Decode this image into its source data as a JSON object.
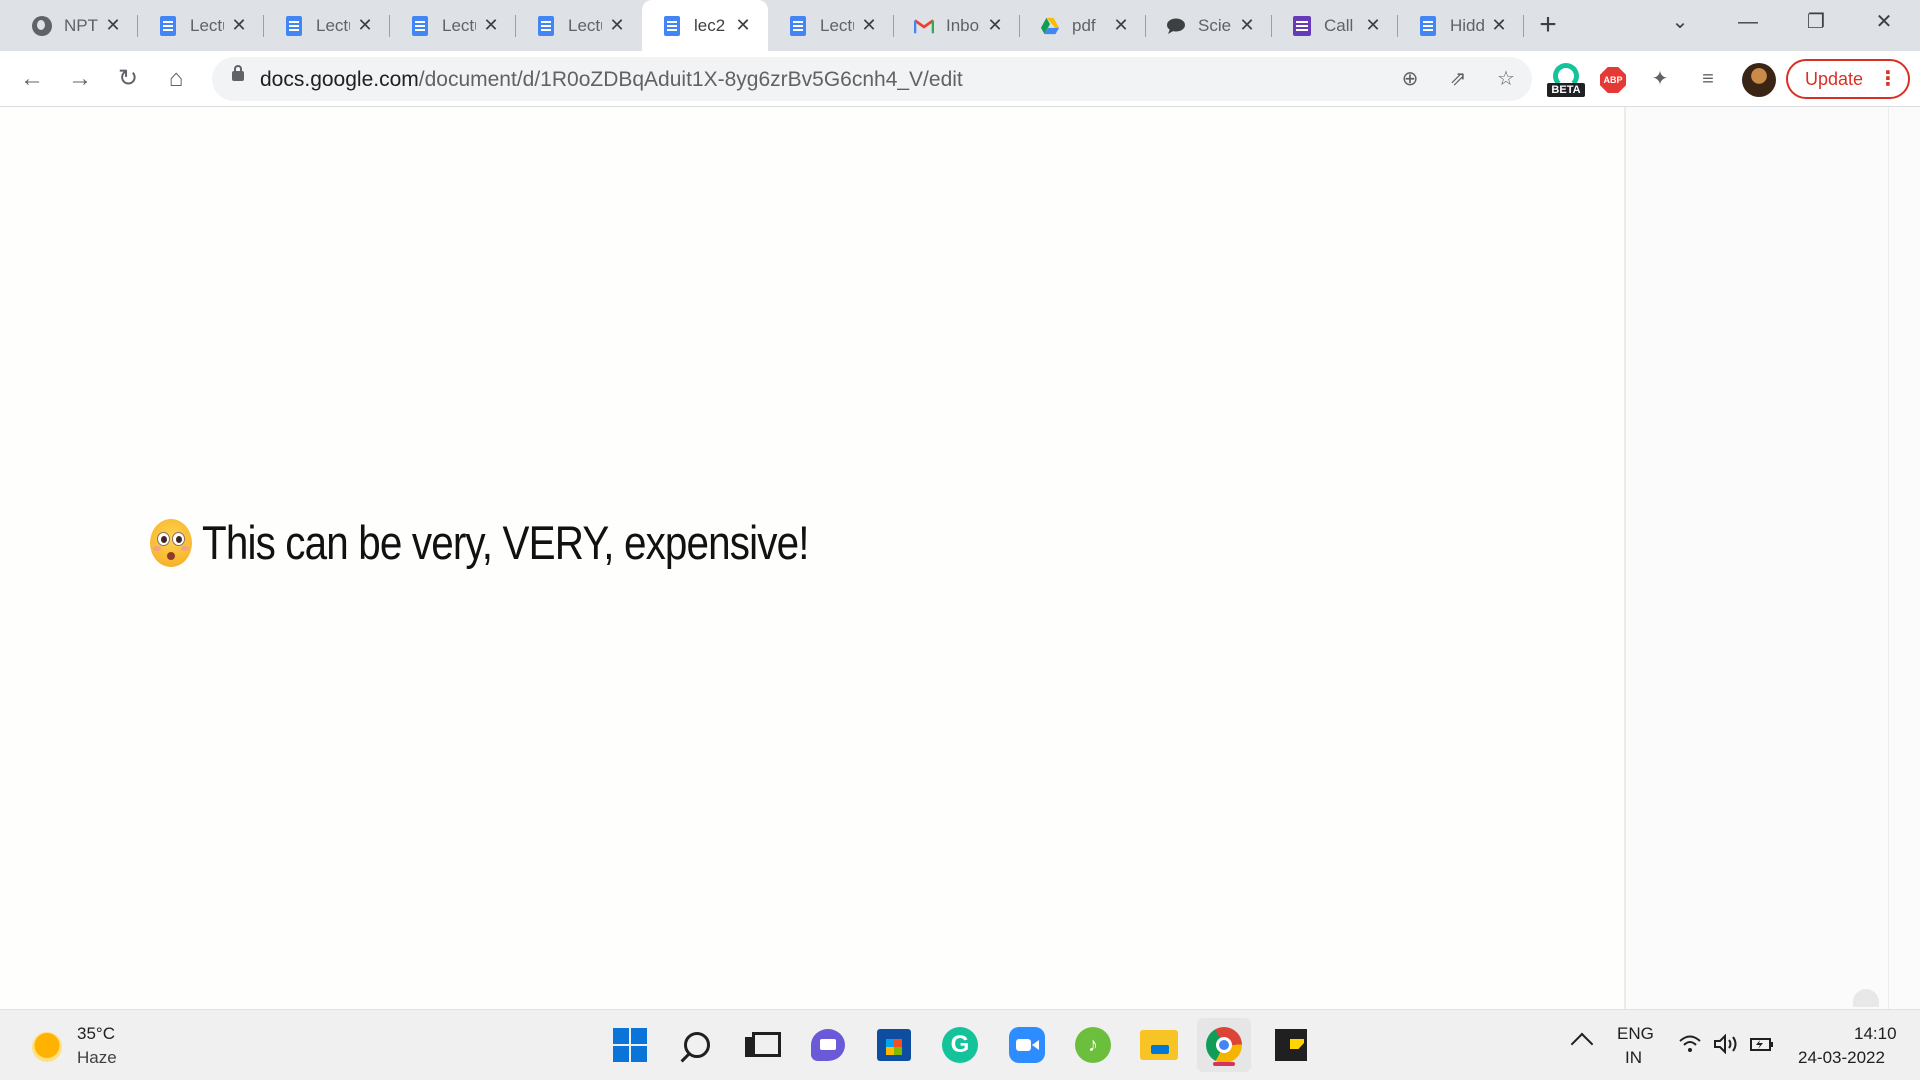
{
  "browser": {
    "tabs": [
      {
        "title": "NPTEL",
        "icon": "globe-icon"
      },
      {
        "title": "Lecture",
        "icon": "docs-icon"
      },
      {
        "title": "Lecture",
        "icon": "docs-icon"
      },
      {
        "title": "Lecture",
        "icon": "docs-icon"
      },
      {
        "title": "Lecture",
        "icon": "docs-icon"
      },
      {
        "title": "lec2",
        "icon": "docs-icon",
        "active": true
      },
      {
        "title": "Lecture",
        "icon": "docs-icon"
      },
      {
        "title": "Inbox",
        "icon": "gmail-icon"
      },
      {
        "title": "pdf",
        "icon": "drive-icon"
      },
      {
        "title": "Science",
        "icon": "chat-icon"
      },
      {
        "title": "Call",
        "icon": "forms-icon"
      },
      {
        "title": "Hidden",
        "icon": "docs-icon"
      }
    ],
    "new_tab": "+",
    "url_host": "docs.google.com",
    "url_path": "/document/d/1R0oZDBqAduit1X-8yg6zrBv5G6cnh4_V/edit",
    "update_label": "Update",
    "extensions": {
      "beta_label": "BETA",
      "abp_label": "ABP"
    }
  },
  "document": {
    "headline": "This can be very, VERY, expensive!"
  },
  "taskbar": {
    "weather_temp": "35°C",
    "weather_desc": "Haze",
    "lang_line1": "ENG",
    "lang_line2": "IN",
    "time": "14:10",
    "date": "24-03-2022"
  },
  "colors": {
    "accent_update": "#d93025",
    "docs_blue": "#4285f4",
    "chrome_active_indicator": "#d7325e"
  }
}
